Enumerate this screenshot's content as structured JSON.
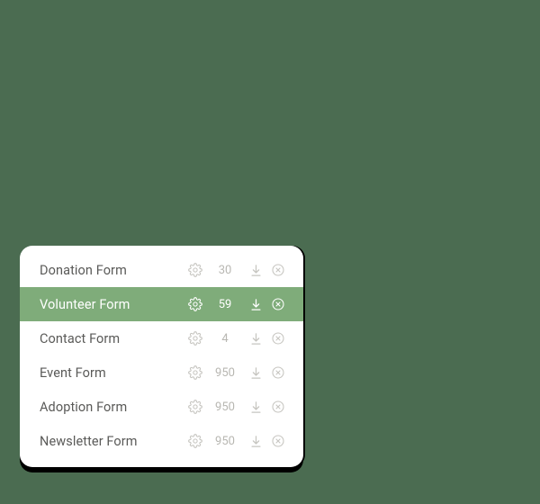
{
  "colors": {
    "background": "#4b6c51",
    "card": "#ffffff",
    "text": "#5a5a58",
    "muted": "#b8b7b2",
    "selected_bg": "#7fac7a",
    "selected_text": "#ffffff"
  },
  "forms": [
    {
      "name": "Donation Form",
      "count": "30",
      "selected": false
    },
    {
      "name": "Volunteer Form",
      "count": "59",
      "selected": true
    },
    {
      "name": "Contact Form",
      "count": "4",
      "selected": false
    },
    {
      "name": "Event Form",
      "count": "950",
      "selected": false
    },
    {
      "name": "Adoption Form",
      "count": "950",
      "selected": false
    },
    {
      "name": "Newsletter Form",
      "count": "950",
      "selected": false
    }
  ],
  "icons": {
    "gear": "gear-icon",
    "download": "download-icon",
    "close": "close-circle-icon"
  }
}
